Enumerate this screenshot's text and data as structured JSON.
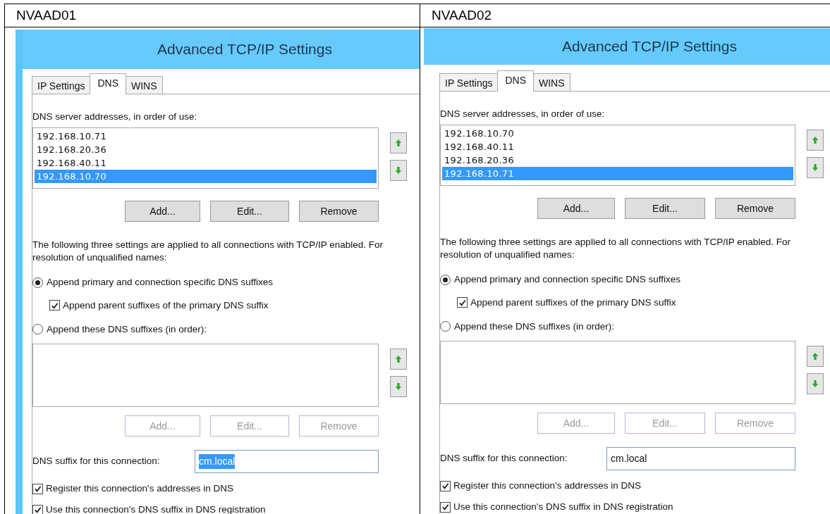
{
  "panels": [
    {
      "heading": "NVAAD01",
      "dialog": {
        "title": "Advanced TCP/IP Settings",
        "tabs": [
          {
            "label": "IP Settings",
            "selected": false
          },
          {
            "label": "DNS",
            "selected": true
          },
          {
            "label": "WINS",
            "selected": false
          }
        ],
        "servers_label": "DNS server addresses, in order of use:",
        "servers": [
          {
            "address": "192.168.10.71",
            "selected": false
          },
          {
            "address": "192.168.20.36",
            "selected": false
          },
          {
            "address": "192.168.40.11",
            "selected": false
          },
          {
            "address": "192.168.10.70",
            "selected": true
          }
        ],
        "server_buttons": [
          {
            "label": "Add...",
            "disabled": false
          },
          {
            "label": "Edit...",
            "disabled": false
          },
          {
            "label": "Remove",
            "disabled": false
          }
        ],
        "info_text": "The following three settings are applied to all connections with TCP/IP enabled. For resolution of unqualified names:",
        "radio_primary": {
          "label": "Append primary and connection specific DNS suffixes",
          "selected": true
        },
        "parent_checkbox": {
          "label": "Append parent suffixes of the primary DNS suffix",
          "checked": true
        },
        "radio_these": {
          "label": "Append these DNS suffixes (in order):",
          "selected": false
        },
        "suffix_buttons": [
          {
            "label": "Add...",
            "disabled": true
          },
          {
            "label": "Edit...",
            "disabled": true
          },
          {
            "label": "Remove",
            "disabled": true
          }
        ],
        "suffix_label": "DNS suffix for this connection:",
        "suffix_value": "cm.local",
        "suffix_value_highlighted": true,
        "checkboxes": [
          {
            "label": "Register this connection's addresses in DNS",
            "checked": true
          },
          {
            "label": "Use this connection's DNS suffix in DNS registration",
            "checked": true
          }
        ]
      }
    },
    {
      "heading": "NVAAD02",
      "dialog": {
        "title": "Advanced TCP/IP Settings",
        "tabs": [
          {
            "label": "IP Settings",
            "selected": false
          },
          {
            "label": "DNS",
            "selected": true
          },
          {
            "label": "WINS",
            "selected": false
          }
        ],
        "servers_label": "DNS server addresses, in order of use:",
        "servers": [
          {
            "address": "192.168.10.70",
            "selected": false
          },
          {
            "address": "192.168.40.11",
            "selected": false
          },
          {
            "address": "192.168.20.36",
            "selected": false
          },
          {
            "address": "192.168.10.71",
            "selected": true
          }
        ],
        "server_buttons": [
          {
            "label": "Add...",
            "disabled": false
          },
          {
            "label": "Edit...",
            "disabled": false
          },
          {
            "label": "Remove",
            "disabled": false
          }
        ],
        "info_text": "The following three settings are applied to all connections with TCP/IP enabled. For resolution of unqualified names:",
        "radio_primary": {
          "label": "Append primary and connection specific DNS suffixes",
          "selected": true
        },
        "parent_checkbox": {
          "label": "Append parent suffixes of the primary DNS suffix",
          "checked": true
        },
        "radio_these": {
          "label": "Append these DNS suffixes (in order):",
          "selected": false
        },
        "suffix_buttons": [
          {
            "label": "Add...",
            "disabled": true
          },
          {
            "label": "Edit...",
            "disabled": true
          },
          {
            "label": "Remove",
            "disabled": true
          }
        ],
        "suffix_label": "DNS suffix for this connection:",
        "suffix_value": "cm.local",
        "suffix_value_highlighted": false,
        "checkboxes": [
          {
            "label": "Register this connection's addresses in DNS",
            "checked": true
          },
          {
            "label": "Use this connection's DNS suffix in DNS registration",
            "checked": true
          }
        ]
      }
    }
  ]
}
